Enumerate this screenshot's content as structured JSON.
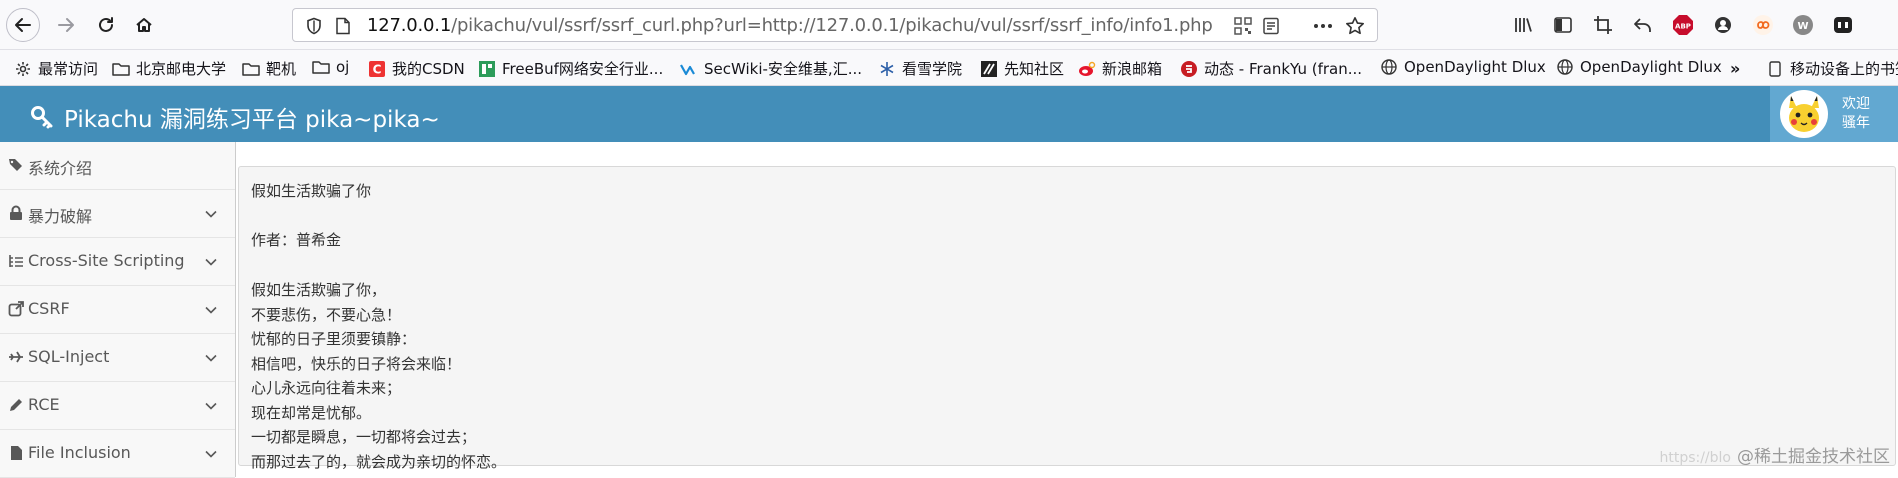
{
  "browser": {
    "url_host": "127.0.0.1",
    "url_path": "/pikachu/vul/ssrf/ssrf_curl.php?url=http://127.0.0.1/pikachu/vul/ssrf/ssrf_info/info1.php"
  },
  "bookmarks": [
    {
      "label": "最常访问",
      "icon": "gear-icon"
    },
    {
      "label": "北京邮电大学",
      "icon": "folder-icon"
    },
    {
      "label": "靶机",
      "icon": "folder-icon"
    },
    {
      "label": "oj",
      "icon": "folder-icon"
    },
    {
      "label": "我的CSDN",
      "icon": "csdn-icon"
    },
    {
      "label": "FreeBuf网络安全行业...",
      "icon": "freebuf-icon"
    },
    {
      "label": "SecWiki-安全维基,汇...",
      "icon": "secwiki-icon"
    },
    {
      "label": "看雪学院",
      "icon": "snowflake-icon"
    },
    {
      "label": "先知社区",
      "icon": "xianzhi-icon"
    },
    {
      "label": "新浪邮箱",
      "icon": "weibo-icon"
    },
    {
      "label": "动态 - FrankYu (fran...",
      "icon": "gitee-icon"
    },
    {
      "label": "OpenDaylight Dlux",
      "icon": "globe-icon"
    },
    {
      "label": "OpenDaylight Dlux",
      "icon": "globe-icon"
    },
    {
      "label": "移动设备上的书签",
      "icon": "mobile-icon"
    }
  ],
  "header": {
    "title": "Pikachu 漏洞练习平台 pika~pika~",
    "welcome_line1": "欢迎",
    "welcome_line2": "骚年"
  },
  "sidebar": {
    "items": [
      {
        "label": "系统介绍",
        "icon": "tags-icon",
        "expandable": false
      },
      {
        "label": "暴力破解",
        "icon": "lock-icon",
        "expandable": true
      },
      {
        "label": "Cross-Site Scripting",
        "icon": "list-icon",
        "expandable": true
      },
      {
        "label": "CSRF",
        "icon": "external-link-icon",
        "expandable": true
      },
      {
        "label": "SQL-Inject",
        "icon": "plane-icon",
        "expandable": true
      },
      {
        "label": "RCE",
        "icon": "pencil-icon",
        "expandable": true
      },
      {
        "label": "File Inclusion",
        "icon": "file-icon",
        "expandable": true
      }
    ]
  },
  "poem": {
    "title": "假如生活欺骗了你",
    "author": "作者：普希金",
    "lines": [
      "假如生活欺骗了你，",
      "不要悲伤，不要心急！",
      "忧郁的日子里须要镇静：",
      "相信吧，快乐的日子将会来临！",
      "心儿永远向往着未来；",
      "现在却常是忧郁。",
      "一切都是瞬息，一切都将会过去；",
      "而那过去了的，就会成为亲切的怀恋。"
    ]
  },
  "watermark": {
    "faint": "https://blo",
    "text": "@稀土掘金技术社区"
  },
  "colors": {
    "header_bg": "#438eb9",
    "user_box_bg": "#62a8d1",
    "sidebar_bg": "#f8f8f8",
    "content_box_bg": "#f5f5f5"
  }
}
